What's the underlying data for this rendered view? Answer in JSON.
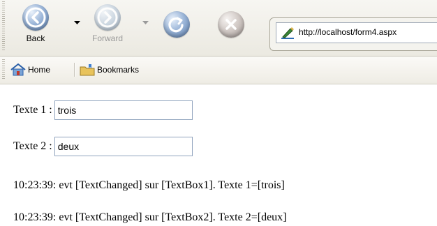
{
  "toolbar": {
    "back_label": "Back",
    "forward_label": "Forward",
    "address_url": "http://localhost/form4.aspx"
  },
  "bookmarks": {
    "home_label": "Home",
    "bookmarks_label": "Bookmarks"
  },
  "form": {
    "texte1_label": "Texte 1 :",
    "texte1_value": "trois",
    "texte2_label": "Texte 2 :",
    "texte2_value": "deux"
  },
  "log": [
    "10:23:39: evt [TextChanged] sur [TextBox1]. Texte 1=[trois]",
    "10:23:39: evt [TextChanged] sur [TextBox2]. Texte 2=[deux]"
  ],
  "colors": {
    "chrome_bg": "#ebe9e1",
    "input_border": "#8fa3bd",
    "nav_blue": "#5c7fb0"
  }
}
